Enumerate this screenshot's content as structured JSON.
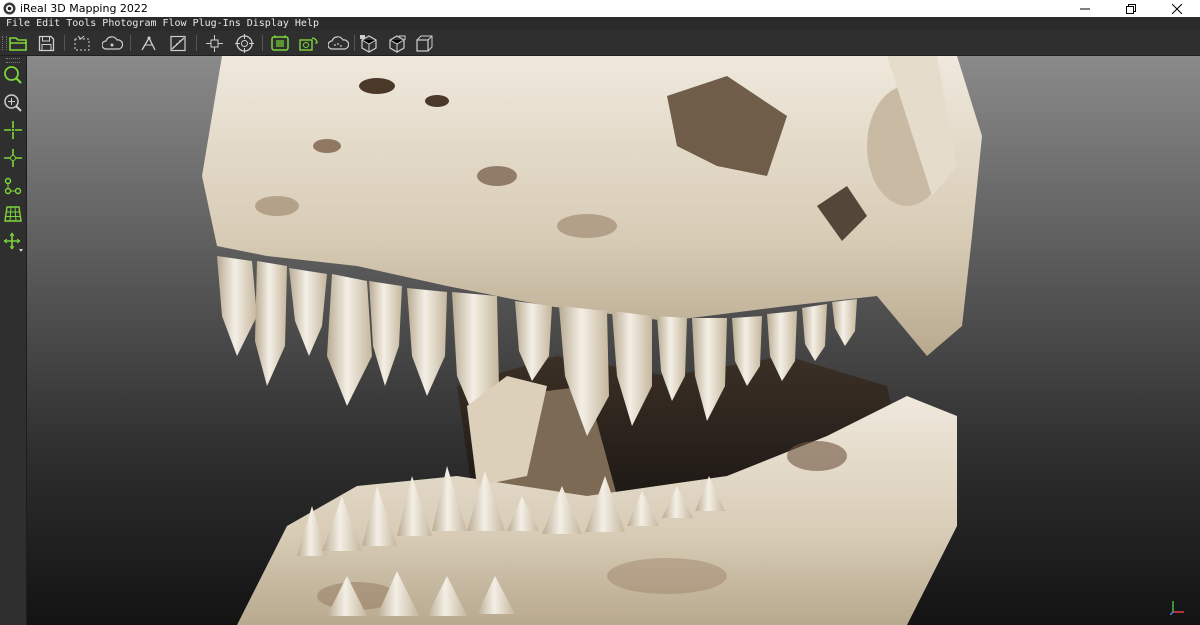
{
  "window": {
    "title": "iReal 3D Mapping 2022"
  },
  "menu": [
    "File",
    "Edit",
    "Tools",
    "Photogram",
    "Flow",
    "Plug-Ins",
    "Display",
    "Help"
  ],
  "toolbar_icons": [
    "open-folder-icon",
    "save-icon",
    "region-select-icon",
    "cloud-gcp-icon",
    "measure-icon",
    "scale-icon",
    "move-object-icon",
    "target-icon",
    "auto-build-icon",
    "camera-align-icon",
    "point-cloud-icon",
    "mesh-icon",
    "texture-icon",
    "export-model-icon"
  ],
  "left_tools": [
    "zoom-icon",
    "zoom-fit-icon",
    "add-point-icon",
    "point-pick-icon",
    "path-icon",
    "grid-icon",
    "transform-icon"
  ],
  "colors": {
    "accent_green": "#7dd63a",
    "toolbar_bg": "#2f2f2f",
    "menubar_bg": "#2b2b2b"
  }
}
